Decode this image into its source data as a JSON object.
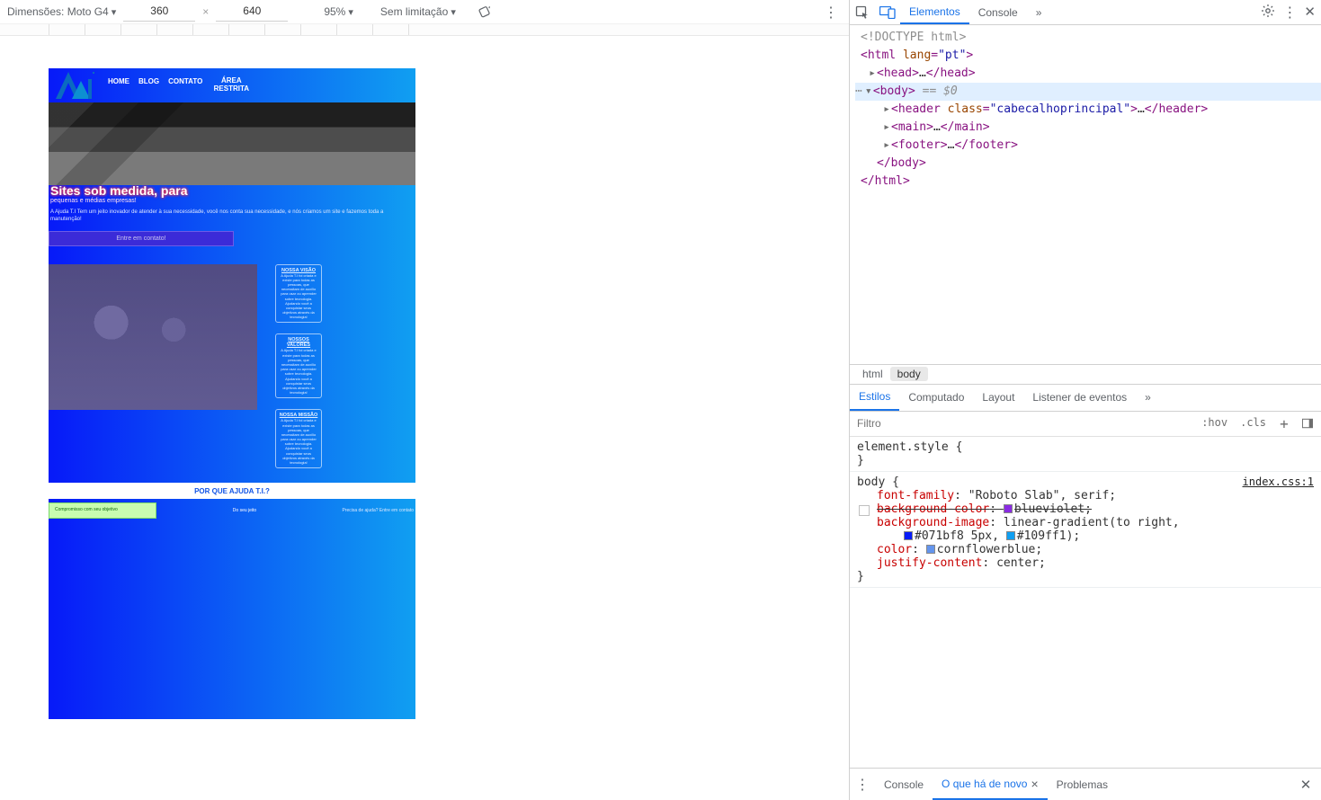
{
  "device_toolbar": {
    "label": "Dimensões: Moto G4",
    "width": "360",
    "height": "640",
    "zoom": "95%",
    "throttle": "Sem limitação"
  },
  "devtools": {
    "tabs": {
      "elements": "Elementos",
      "console": "Console",
      "more": "»"
    },
    "dom": {
      "doctype": "<!DOCTYPE html>",
      "html_open_pre": "<",
      "html_tag": "html",
      "html_lang_attr": "lang",
      "html_lang_val": "\"pt\"",
      "html_open_post": ">",
      "head_open": "<head>",
      "head_ell": "…",
      "head_close": "</head>",
      "body_open": "<body>",
      "body_sel_suffix": " == $0",
      "header_open_pre": "<",
      "header_tag": "header",
      "header_class_attr": "class",
      "header_class_val": "\"cabecalhoprincipal\"",
      "header_open_post": ">",
      "header_ell": "…",
      "header_close": "</header>",
      "main_open": "<main>",
      "main_ell": "…",
      "main_close": "</main>",
      "footer_open": "<footer>",
      "footer_ell": "…",
      "footer_close": "</footer>",
      "body_close": "</body>",
      "html_close": "</html>"
    },
    "crumbs": {
      "html": "html",
      "body": "body"
    },
    "styles_tabs": {
      "styles": "Estilos",
      "computed": "Computado",
      "layout": "Layout",
      "listeners": "Listener de eventos",
      "more": "»"
    },
    "filter_placeholder": "Filtro",
    "toggles": {
      "hov": ":hov",
      "cls": ".cls",
      "plus": "+"
    },
    "rules": {
      "elstyle_sel": "element.style",
      "brace_open": " {",
      "brace_close": "}",
      "body_sel": "body",
      "src": "index.css:1",
      "ff_name": "font-family",
      "ff_val": "\"Roboto Slab\", serif;",
      "bgc_name": "background-color",
      "bgc_val": "blueviolet;",
      "bgc_hex": "#8a2be2",
      "bgi_name": "background-image",
      "bgi_val_pre": "linear-gradient(to right,",
      "bgi_c1": "#071bf8",
      "bgi_c1_sfx": " 5px, ",
      "bgi_c2": "#109ff1",
      "bgi_c2_sfx": ");",
      "col_name": "color",
      "col_val": "cornflowerblue;",
      "col_hex": "#6495ed",
      "jc_name": "justify-content",
      "jc_val": "center;"
    },
    "drawer": {
      "console": "Console",
      "whatsnew": "O que há de novo",
      "problems": "Problemas"
    }
  },
  "site": {
    "nav": {
      "home": "HOME",
      "blog": "BLOG",
      "contato": "CONTATO",
      "area": "ÁREA RESTRITA"
    },
    "hero_title": "Sites sob medida, para",
    "hero_sub": "pequenas e médias empresas!",
    "hero_desc": "A Ajuda T.I Tem um jeito inovador de atender à sua necessidade, você nos conta sua necessidade, e nós criamos um site e fazemos toda a manutenção!",
    "cta": "Entre em contato!",
    "card1_t": "NOSSA VISÃO",
    "card1_p": "A Ajuda T.I foi criada e existe para todas as pessoas, que necessitam de auxílio para usar ou aprender sobre tecnologia. Ajudando você a conquistar seus objetivos através da tecnologia!",
    "card2_t": "NOSSOS VALORES",
    "card2_p": "A Ajuda T.I foi criada e existe para todas as pessoas, que necessitam de auxílio para usar ou aprender sobre tecnologia. Ajudando você a conquistar seus objetivos através da tecnologia!",
    "card3_t": "NOSSA MISSÃO",
    "card3_p": "A Ajuda T.I foi criada e existe para todas as pessoas, que necessitam de auxílio para usar ou aprender sobre tecnologia. Ajudando você a conquistar seus objetivos através da tecnologia!",
    "why": "POR QUE AJUDA T.I.?",
    "b_left": "Compromisso com seu objetivo",
    "b_mid": "Do seu jeito",
    "b_right": "Precisa de ajuda? Entre em contato"
  }
}
